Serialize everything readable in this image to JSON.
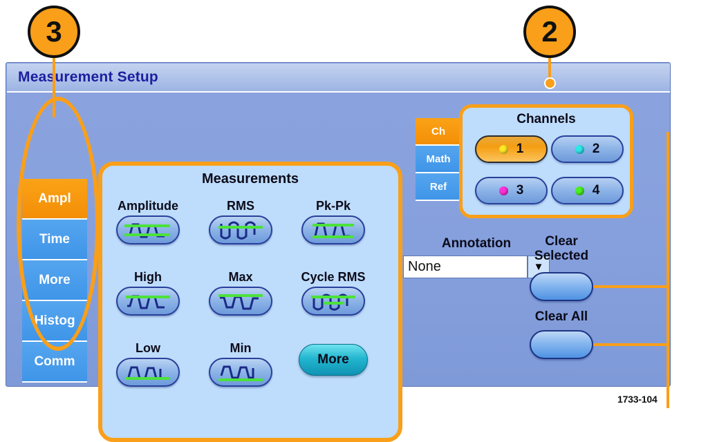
{
  "dialog": {
    "title": "Measurement Setup"
  },
  "left_tabs": [
    {
      "label": "Ampl",
      "selected": true
    },
    {
      "label": "Time",
      "selected": false
    },
    {
      "label": "More",
      "selected": false
    },
    {
      "label": "Histog",
      "selected": false
    },
    {
      "label": "Comm",
      "selected": false
    }
  ],
  "measurements": {
    "title": "Measurements",
    "items": [
      {
        "label": "Amplitude",
        "icon": "amplitude-waveform-icon"
      },
      {
        "label": "RMS",
        "icon": "rms-waveform-icon"
      },
      {
        "label": "Pk-Pk",
        "icon": "pk-pk-waveform-icon"
      },
      {
        "label": "High",
        "icon": "high-waveform-icon"
      },
      {
        "label": "Max",
        "icon": "max-waveform-icon"
      },
      {
        "label": "Cycle RMS",
        "icon": "cycle-rms-waveform-icon"
      },
      {
        "label": "Low",
        "icon": "low-waveform-icon"
      },
      {
        "label": "Min",
        "icon": "min-waveform-icon"
      }
    ],
    "more_button": "More"
  },
  "source_tabs": [
    {
      "label": "Ch",
      "selected": true
    },
    {
      "label": "Math",
      "selected": false
    },
    {
      "label": "Ref",
      "selected": false
    }
  ],
  "channels": {
    "title": "Channels",
    "items": [
      {
        "label": "1",
        "color": "#ffe926",
        "selected": true
      },
      {
        "label": "2",
        "color": "#2ee8e8",
        "selected": false
      },
      {
        "label": "3",
        "color": "#ff30d8",
        "selected": false
      },
      {
        "label": "4",
        "color": "#4cf024",
        "selected": false
      }
    ]
  },
  "annotation": {
    "label": "Annotation",
    "value": "None",
    "arrow": "▼"
  },
  "clear_selected": {
    "line1": "Clear",
    "line2": "Selected"
  },
  "clear_all": {
    "label": "Clear All"
  },
  "callouts": [
    {
      "number": "3"
    },
    {
      "number": "2"
    }
  ],
  "caption": "1733-104",
  "colors": {
    "accent_orange": "#f99f19",
    "panel_light": "#bedcfb",
    "dialog_blue": "#86a0dd",
    "title_text": "#1d1fa0",
    "waveform": "#1b2a86",
    "marker_green": "#4ce23a"
  }
}
